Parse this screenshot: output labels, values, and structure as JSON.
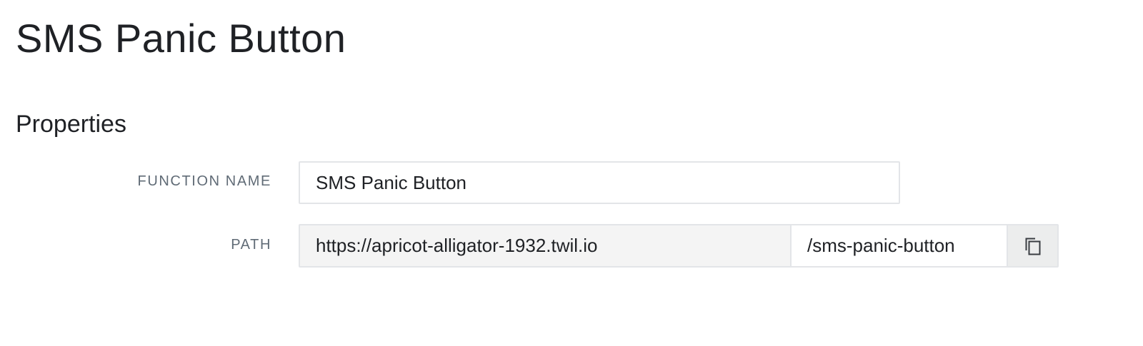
{
  "header": {
    "title": "SMS Panic Button"
  },
  "properties": {
    "section_title": "Properties",
    "function_name": {
      "label": "FUNCTION NAME",
      "value": "SMS Panic Button"
    },
    "path": {
      "label": "PATH",
      "domain": "https://apricot-alligator-1932.twil.io",
      "value": "/sms-panic-button",
      "copy_icon": "copy-icon"
    }
  },
  "colors": {
    "text": "#1f2125",
    "label": "#606b76",
    "border": "#e3e5e8",
    "readonly_bg": "#f4f4f4",
    "button_bg": "#eceded"
  }
}
